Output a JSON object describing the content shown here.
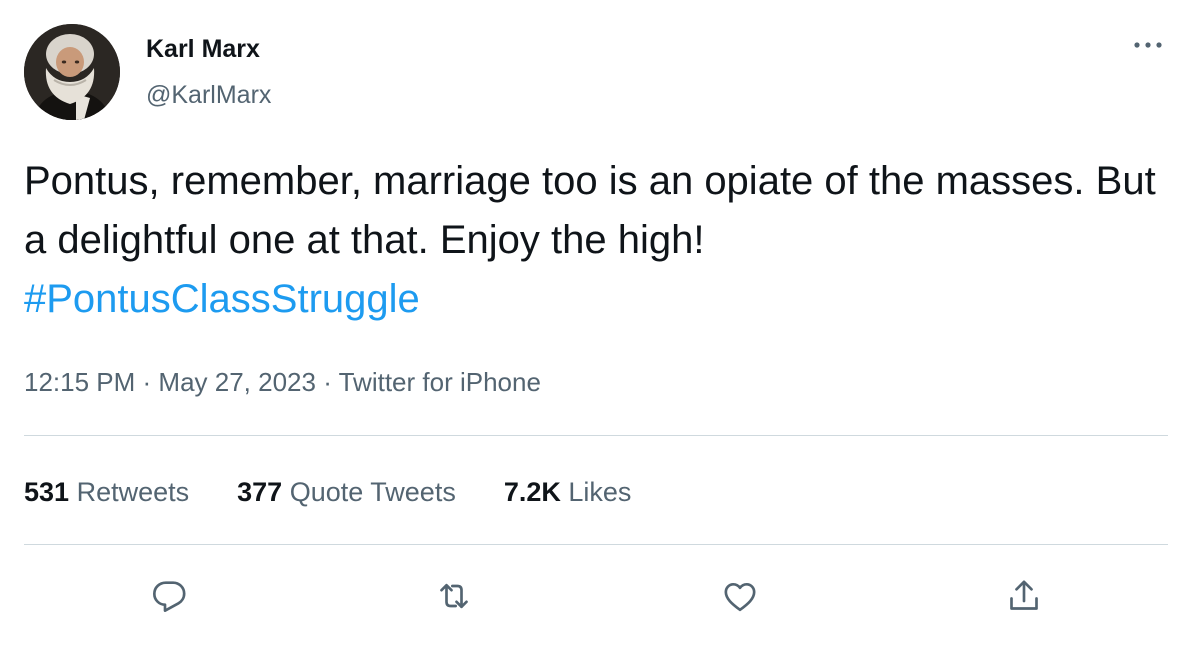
{
  "author": {
    "name": "Karl Marx",
    "handle": "@KarlMarx"
  },
  "tweet": {
    "text": "Pontus, remember, marriage too is an opiate of the masses. But a delightful one at that. Enjoy the high!",
    "hashtag": "#PontusClassStruggle"
  },
  "meta": {
    "time": "12:15 PM",
    "date": "May 27, 2023",
    "source": "Twitter for iPhone",
    "separator": " · "
  },
  "stats": {
    "retweets_count": "531",
    "retweets_label": "Retweets",
    "quotes_count": "377",
    "quotes_label": "Quote Tweets",
    "likes_count": "7.2K",
    "likes_label": "Likes"
  },
  "icons": {
    "more": "more-horizontal-icon",
    "reply": "reply-icon",
    "retweet": "retweet-icon",
    "like": "heart-icon",
    "share": "share-icon"
  },
  "colors": {
    "text": "#0f1419",
    "secondary": "#536471",
    "link": "#1d9bf0",
    "divider": "#cfd9de"
  }
}
